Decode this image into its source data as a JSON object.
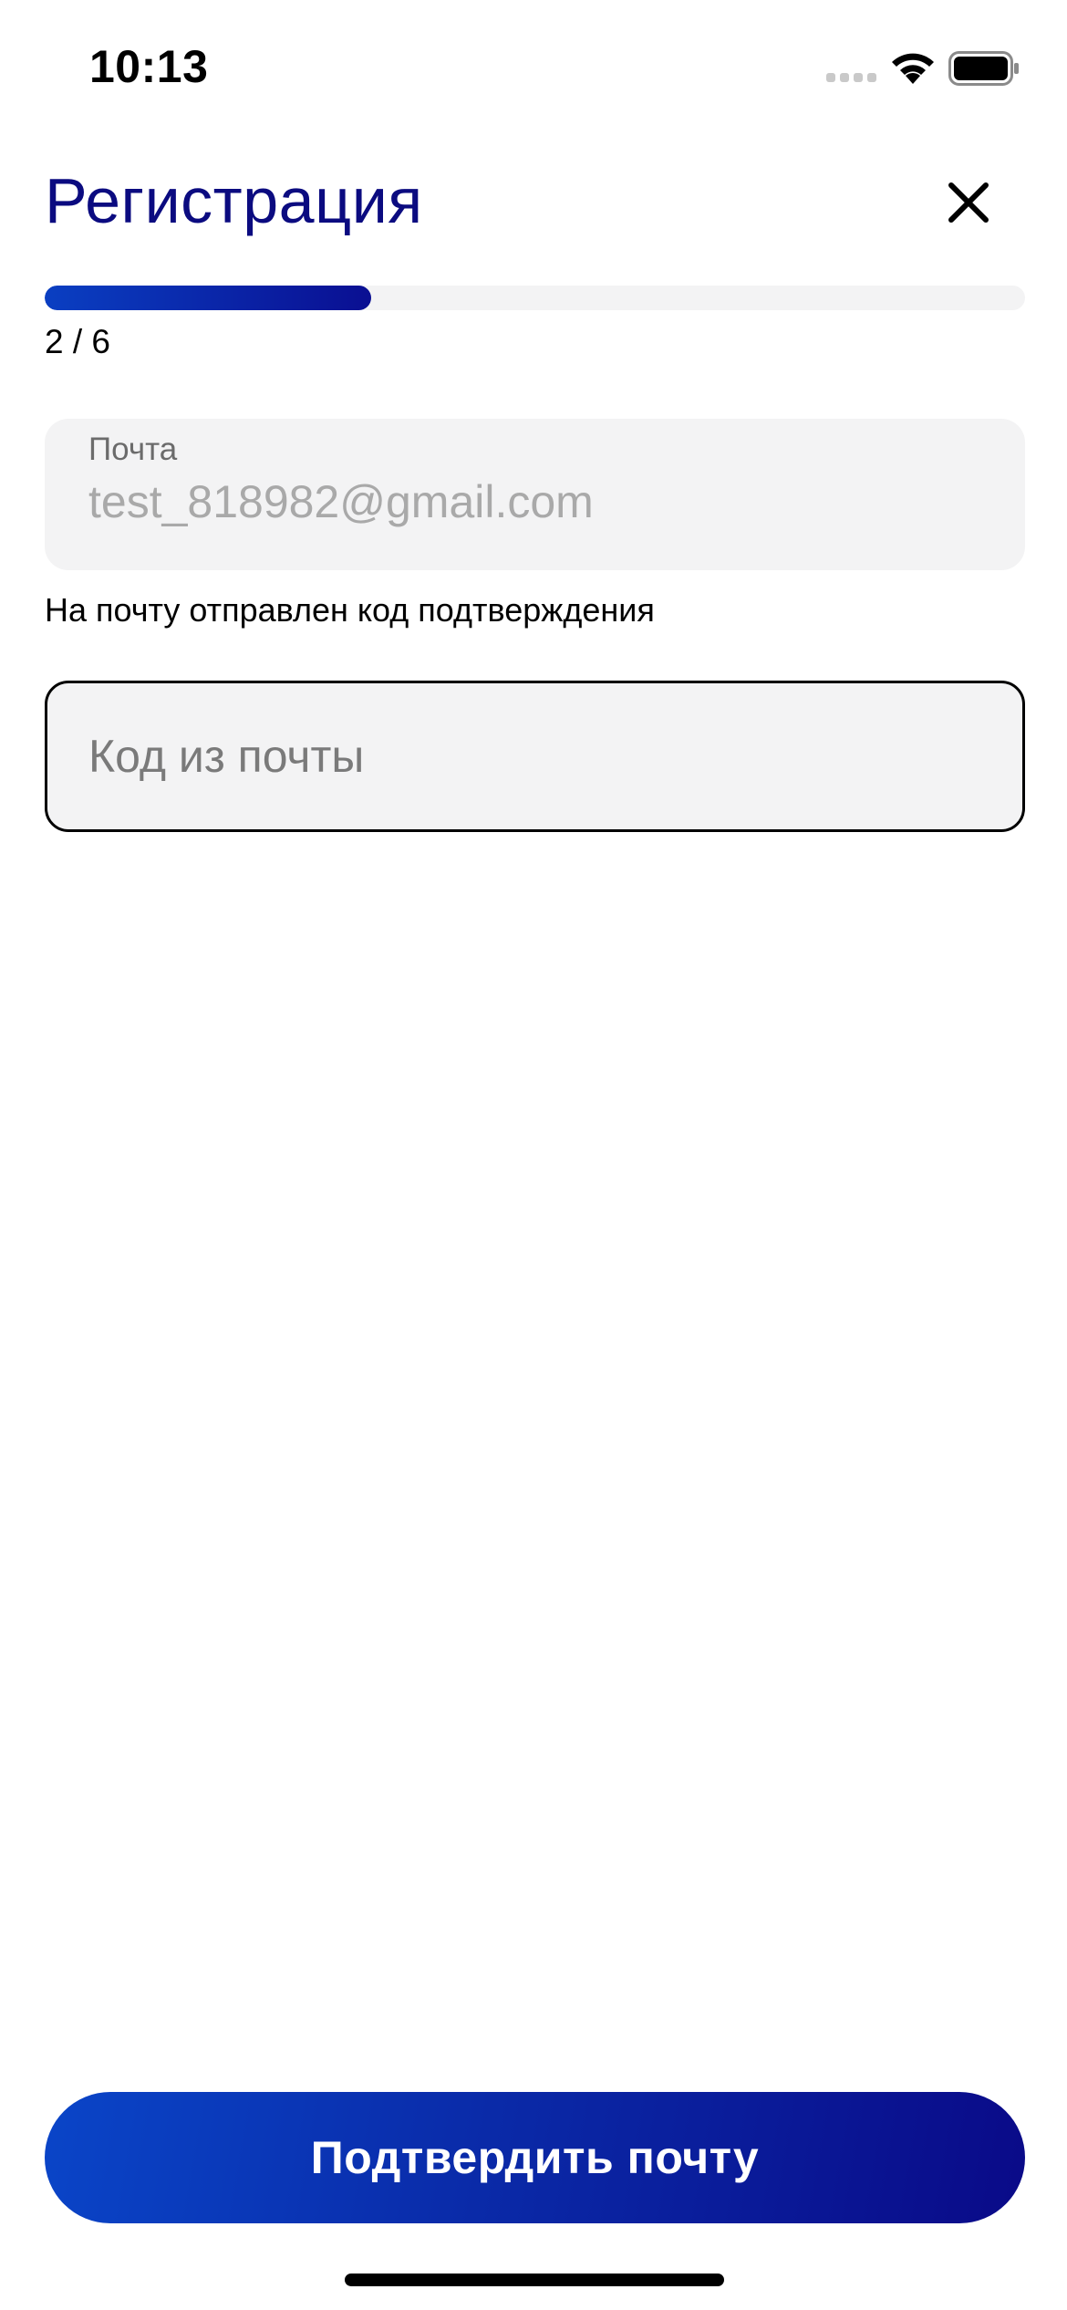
{
  "status_bar": {
    "time": "10:13",
    "icons": [
      "signal-icon",
      "wifi-icon",
      "battery-icon"
    ]
  },
  "header": {
    "title": "Регистрация",
    "close_icon": "close-icon"
  },
  "progress": {
    "label": "2 / 6",
    "current_step": 2,
    "total_steps": 6,
    "fill_fraction": 0.333
  },
  "email_field": {
    "label": "Почта",
    "value": "test_818982@gmail.com"
  },
  "helper_text": "На почту отправлен код подтверждения",
  "code_field": {
    "placeholder": "Код из почты",
    "value": ""
  },
  "confirm_button": {
    "label": "Подтвердить почту"
  },
  "colors": {
    "title": "#0b0b80",
    "accent_start": "#0a45c8",
    "accent_end": "#0a0a88",
    "field_bg": "#f3f3f4"
  }
}
